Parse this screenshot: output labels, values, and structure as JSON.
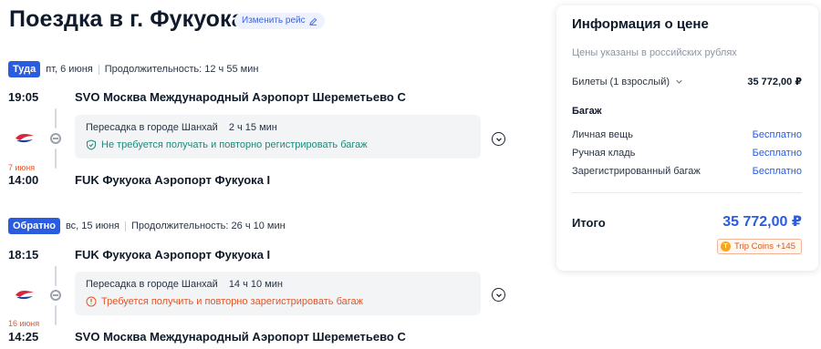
{
  "page": {
    "title": "Поездка в г. Фукуока",
    "change_flight": "Изменить рейс"
  },
  "outbound": {
    "badge": "Туда",
    "date": "пт, 6 июня",
    "duration": "Продолжительность: 12 ч 55 мин",
    "dep_time": "19:05",
    "dep_airport": "SVO Москва Международный Аэропорт Шереметьево C",
    "transfer_city": "Пересадка в городе Шанхай",
    "transfer_time": "2 ч 15 мин",
    "baggage_note": "Не требуется получать и повторно регистрировать багаж",
    "arr_date": "7 июня",
    "arr_time": "14:00",
    "arr_airport": "FUK Фукуока Аэропорт Фукуока I"
  },
  "return": {
    "badge": "Обратно",
    "date": "вс, 15 июня",
    "duration": "Продолжительность: 26 ч 10 мин",
    "dep_time": "18:15",
    "dep_airport": "FUK Фукуока Аэропорт Фукуока I",
    "transfer_city": "Пересадка в городе Шанхай",
    "transfer_time": "14 ч 10 мин",
    "baggage_note": "Требуется получить и повторно зарегистрировать багаж",
    "arr_date": "16 июня",
    "arr_time": "14:25",
    "arr_airport": "SVO Москва Международный Аэропорт Шереметьево C"
  },
  "price": {
    "title": "Информация о цене",
    "subtitle": "Цены указаны в российских рублях",
    "tickets_label": "Билеты (1 взрослый)",
    "tickets_value": "35 772,00 ₽",
    "baggage_title": "Багаж",
    "personal_item": "Личная вещь",
    "personal_item_value": "Бесплатно",
    "carry_on": "Ручная кладь",
    "carry_on_value": "Бесплатно",
    "checked": "Зарегистрированный багаж",
    "checked_value": "Бесплатно",
    "total_label": "Итого",
    "total_value": "35 772,00 ₽",
    "coins": "Trip Coins +145"
  },
  "colors": {
    "accent": "#2b5bde",
    "ok": "#1c8a7a",
    "warn": "#e1572a"
  },
  "icons": [
    "edit-icon",
    "china-eastern-logo",
    "stop-icon",
    "shield-check-icon",
    "warning-icon",
    "chevron-down-icon",
    "coin-icon"
  ]
}
